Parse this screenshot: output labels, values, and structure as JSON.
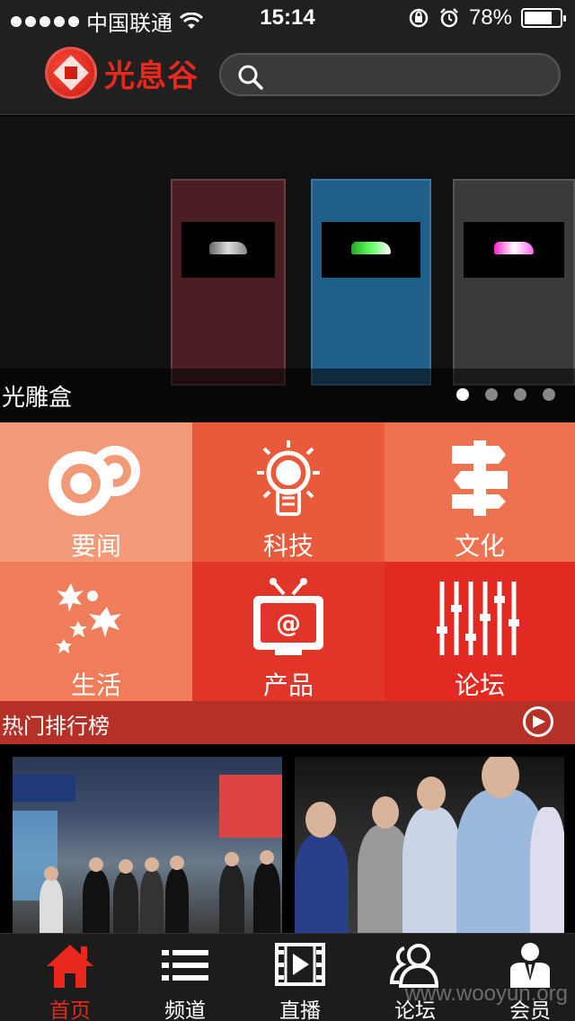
{
  "status_bar": {
    "carrier": "中国联通",
    "time": "15:14",
    "battery_percent": "78%",
    "battery_level": 0.78
  },
  "header": {
    "logo_text": "光息谷",
    "search_placeholder": ""
  },
  "banner": {
    "caption": "光雕盒",
    "page_count": 4,
    "active_page": 1
  },
  "categories": [
    {
      "label": "要闻",
      "icon": "discs-icon",
      "color": "#f29a78"
    },
    {
      "label": "科技",
      "icon": "lightbulb-icon",
      "color": "#e85a3a"
    },
    {
      "label": "文化",
      "icon": "signpost-icon",
      "color": "#ee7150"
    },
    {
      "label": "生活",
      "icon": "sparkles-icon",
      "color": "#ef7c5a"
    },
    {
      "label": "产品",
      "icon": "tv-icon",
      "color": "#e2352a"
    },
    {
      "label": "论坛",
      "icon": "equalizer-icon",
      "color": "#e02a22"
    }
  ],
  "hot_section": {
    "title": "热门排行榜"
  },
  "tabbar": {
    "items": [
      {
        "label": "首页",
        "icon": "home-icon",
        "active": true
      },
      {
        "label": "频道",
        "icon": "list-icon",
        "active": false
      },
      {
        "label": "直播",
        "icon": "film-icon",
        "active": false
      },
      {
        "label": "论坛",
        "icon": "people-icon",
        "active": false
      },
      {
        "label": "会员",
        "icon": "member-icon",
        "active": false
      }
    ]
  },
  "watermark": "www.wooyun.org",
  "colors": {
    "brand_red": "#e8281d",
    "hot_bar": "#b53127",
    "dark_bg": "#202020"
  }
}
